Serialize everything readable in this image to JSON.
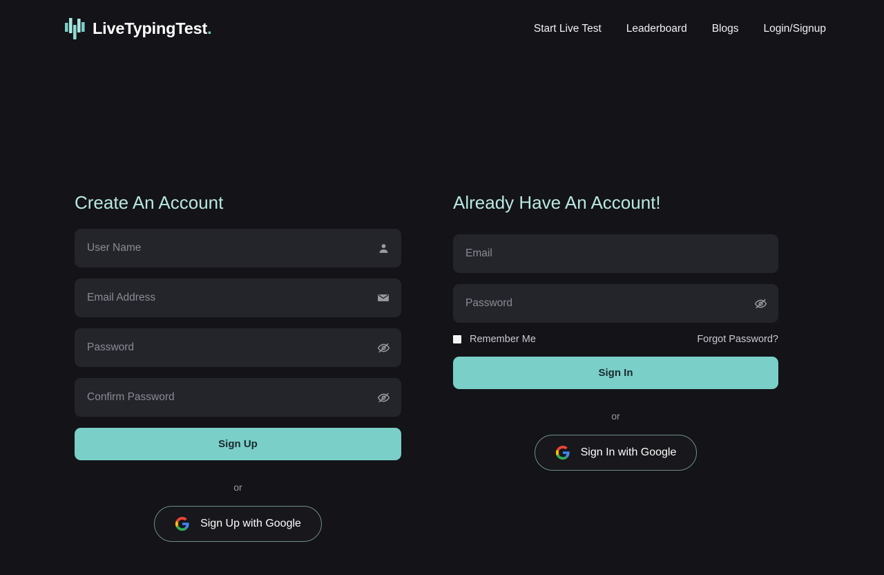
{
  "header": {
    "brand": {
      "name": "LiveTypingTest",
      "dot": ".",
      "logo_icon": "bar-chart-logo-icon",
      "logo_color": "#7ACFC8"
    },
    "nav": [
      {
        "label": "Start Live Test"
      },
      {
        "label": "Leaderboard"
      },
      {
        "label": "Blogs"
      },
      {
        "label": "Login/Signup"
      }
    ]
  },
  "signup": {
    "heading": "Create An Account",
    "fields": [
      {
        "placeholder": "User Name",
        "value": "",
        "icon": "user-icon"
      },
      {
        "placeholder": "Email Address",
        "value": "",
        "icon": "envelope-icon"
      },
      {
        "placeholder": "Password",
        "value": "",
        "icon": "eye-off-icon"
      },
      {
        "placeholder": "Confirm Password",
        "value": "",
        "icon": "eye-off-icon"
      }
    ],
    "submit_label": "Sign Up",
    "or_label": "or",
    "google_label": "Sign Up with Google"
  },
  "signin": {
    "heading": "Already Have An Account!",
    "fields": [
      {
        "placeholder": "Email",
        "value": "",
        "icon": ""
      },
      {
        "placeholder": "Password",
        "value": "",
        "icon": "eye-off-icon"
      }
    ],
    "remember_label": "Remember Me",
    "remember_checked": false,
    "forgot_label": "Forgot Password?",
    "submit_label": "Sign In",
    "or_label": "or",
    "google_label": "Sign In with Google"
  },
  "theme": {
    "background": "#131318",
    "field_background": "#24242B",
    "accent": "#7ACFC8",
    "heading_color": "#B8E8E1",
    "placeholder_color": "#8B8B95"
  }
}
